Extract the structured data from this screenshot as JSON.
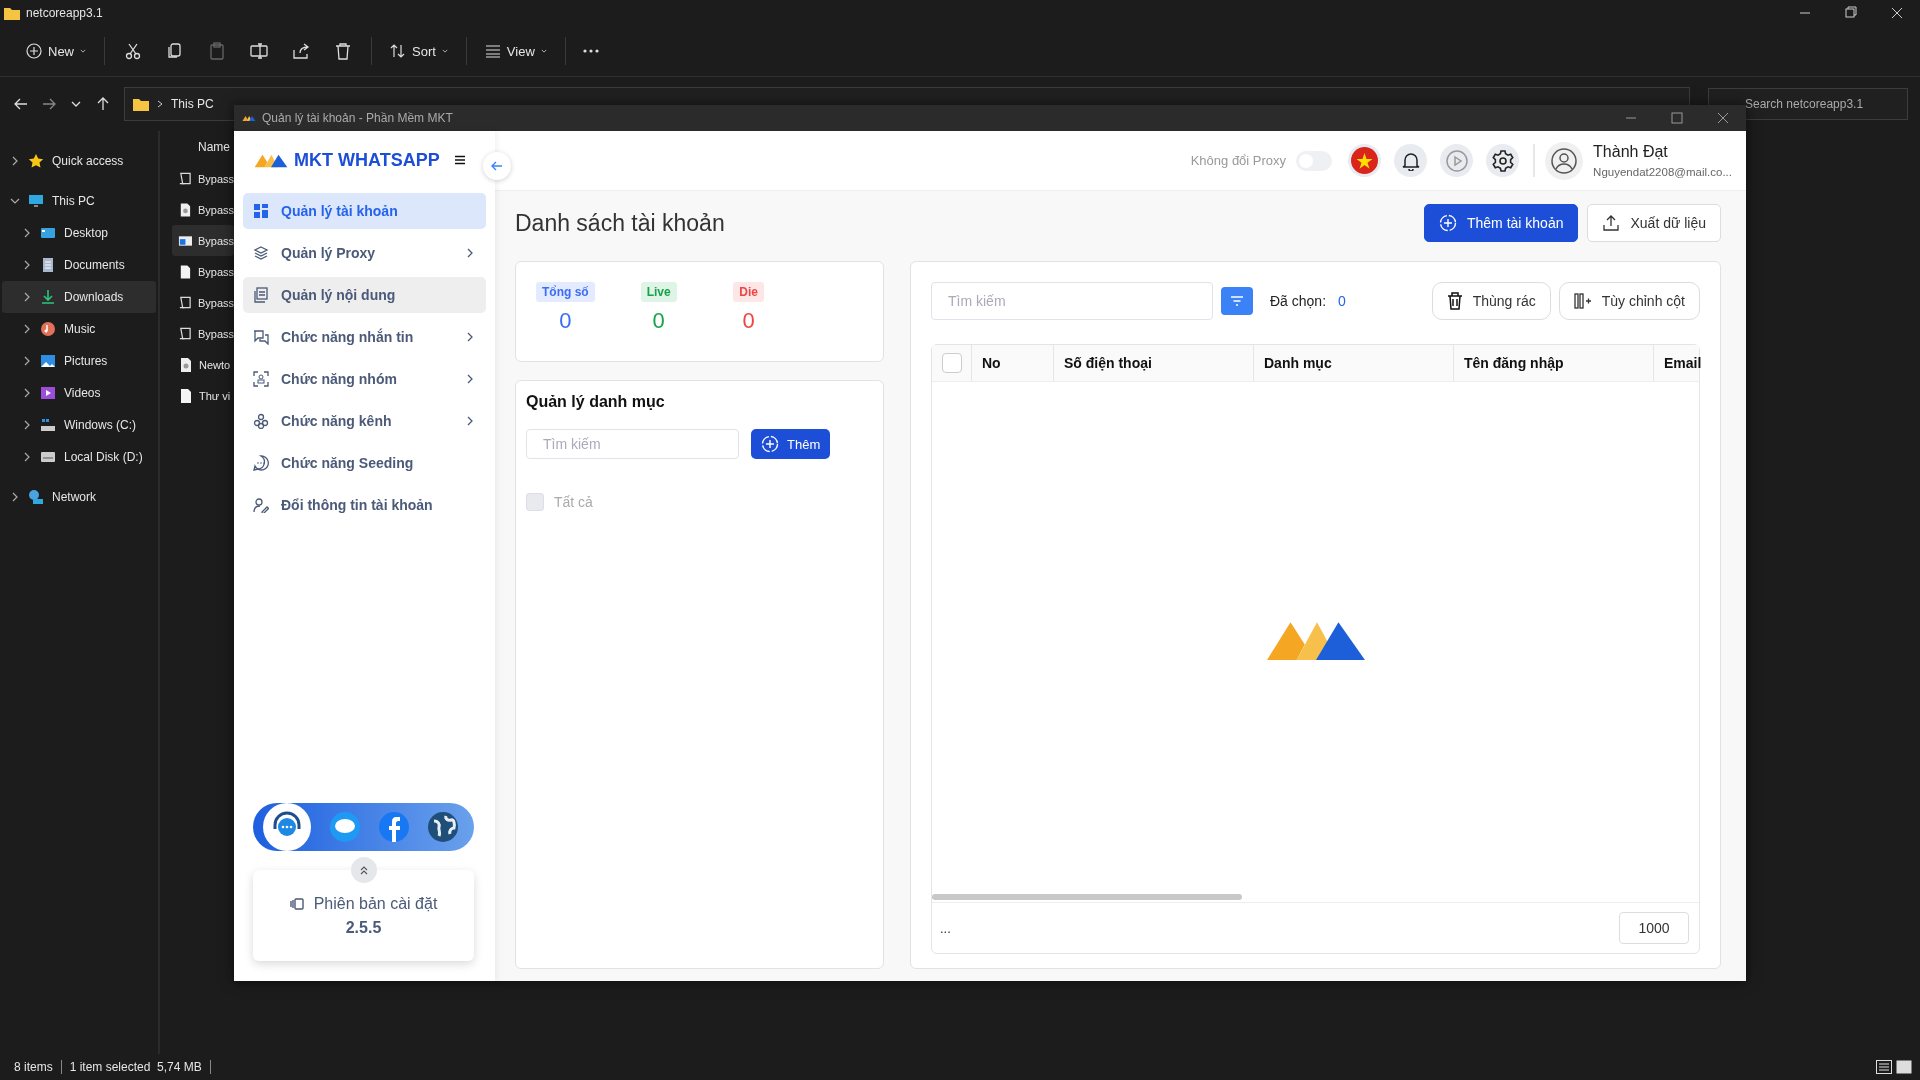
{
  "explorer": {
    "title": "netcoreapp3.1",
    "toolbar": {
      "new_label": "New",
      "sort_label": "Sort",
      "view_label": "View"
    },
    "address": {
      "crumbs": [
        "This PC"
      ],
      "search_placeholder": "Search netcoreapp3.1"
    },
    "nav": [
      {
        "label": "Quick access",
        "expanded": false,
        "selected": false
      },
      {
        "label": "This PC",
        "expanded": true,
        "selected": false,
        "children": [
          {
            "label": "Desktop",
            "expanded": false,
            "selected": false
          },
          {
            "label": "Documents",
            "expanded": false,
            "selected": false
          },
          {
            "label": "Downloads",
            "expanded": false,
            "selected": true
          },
          {
            "label": "Music",
            "expanded": false,
            "selected": false
          },
          {
            "label": "Pictures",
            "expanded": false,
            "selected": false
          },
          {
            "label": "Videos",
            "expanded": false,
            "selected": false
          },
          {
            "label": "Windows (C:)",
            "expanded": false,
            "selected": false
          },
          {
            "label": "Local Disk (D:)",
            "expanded": false,
            "selected": false
          }
        ]
      },
      {
        "label": "Network",
        "expanded": false,
        "selected": false
      }
    ],
    "file_list": {
      "column": "Name",
      "files": [
        {
          "name": "Bypass",
          "kind": "script",
          "selected": false
        },
        {
          "name": "Bypass",
          "kind": "config",
          "selected": false
        },
        {
          "name": "Bypass",
          "kind": "app",
          "selected": true
        },
        {
          "name": "Bypass",
          "kind": "file",
          "selected": false
        },
        {
          "name": "Bypass",
          "kind": "script",
          "selected": false
        },
        {
          "name": "Bypass",
          "kind": "script",
          "selected": false
        },
        {
          "name": "Newto",
          "kind": "config",
          "selected": false
        },
        {
          "name": "Thư vi",
          "kind": "file",
          "selected": false
        }
      ]
    },
    "status_bar": {
      "items": "8 items",
      "selection": "1 item selected  5,74 MB"
    }
  },
  "app": {
    "window": {
      "title": "Quản lý tài khoản - Phần Mềm MKT"
    },
    "brand": "MKT WHATSAPP",
    "menu": [
      {
        "label": "Quản lý tài khoản",
        "selected": true,
        "hovered": false,
        "submenu": false
      },
      {
        "label": "Quản lý Proxy",
        "selected": false,
        "hovered": false,
        "submenu": true
      },
      {
        "label": "Quản lý nội dung",
        "selected": false,
        "hovered": true,
        "submenu": false
      },
      {
        "label": "Chức năng nhắn tin",
        "selected": false,
        "hovered": false,
        "submenu": true
      },
      {
        "label": "Chức năng nhóm",
        "selected": false,
        "hovered": false,
        "submenu": true
      },
      {
        "label": "Chức năng kênh",
        "selected": false,
        "hovered": false,
        "submenu": true
      },
      {
        "label": "Chức năng Seeding",
        "selected": false,
        "hovered": false,
        "submenu": false
      },
      {
        "label": "Đổi thông tin tài khoản",
        "selected": false,
        "hovered": false,
        "submenu": false
      }
    ],
    "version": {
      "label": "Phiên bản cài đặt",
      "number": "2.5.5"
    },
    "header": {
      "proxy_toggle": {
        "label": "Không đổi Proxy",
        "on": false
      },
      "user": {
        "name": "Thành Đạt",
        "email": "Nguyendat2208@mail.co..."
      }
    },
    "page_title": "Danh sách tài khoản",
    "actions": [
      {
        "label": "Thêm tài khoản",
        "kind": "primary"
      },
      {
        "label": "Xuất dữ liệu",
        "kind": "export"
      }
    ],
    "stats": [
      {
        "label": "Tổng số",
        "value": "0",
        "color": "#3b6cf6"
      },
      {
        "label": "Live",
        "value": "0",
        "color": "#16a34a"
      },
      {
        "label": "Die",
        "value": "0",
        "color": "#ef4444"
      }
    ],
    "categories": {
      "title": "Quản lý danh mục",
      "search_placeholder": "Tìm kiếm",
      "add_label": "Thêm",
      "all": {
        "label": "Tất cả",
        "checked": false
      }
    },
    "accounts": {
      "search_placeholder": "Tìm kiếm",
      "selected_label": "Đã chọn:",
      "selected_count": "0",
      "buttons": [
        {
          "label": "Thùng rác",
          "kind": "trash"
        },
        {
          "label": "Tùy chỉnh cột",
          "kind": "columns"
        }
      ],
      "table": {
        "header_checked": false,
        "columns": [
          "No",
          "Số điện thoại",
          "Danh mục",
          "Tên đăng nhập",
          "Email"
        ]
      },
      "footer": {
        "ellipsis": "...",
        "page_size": "1000"
      }
    }
  }
}
